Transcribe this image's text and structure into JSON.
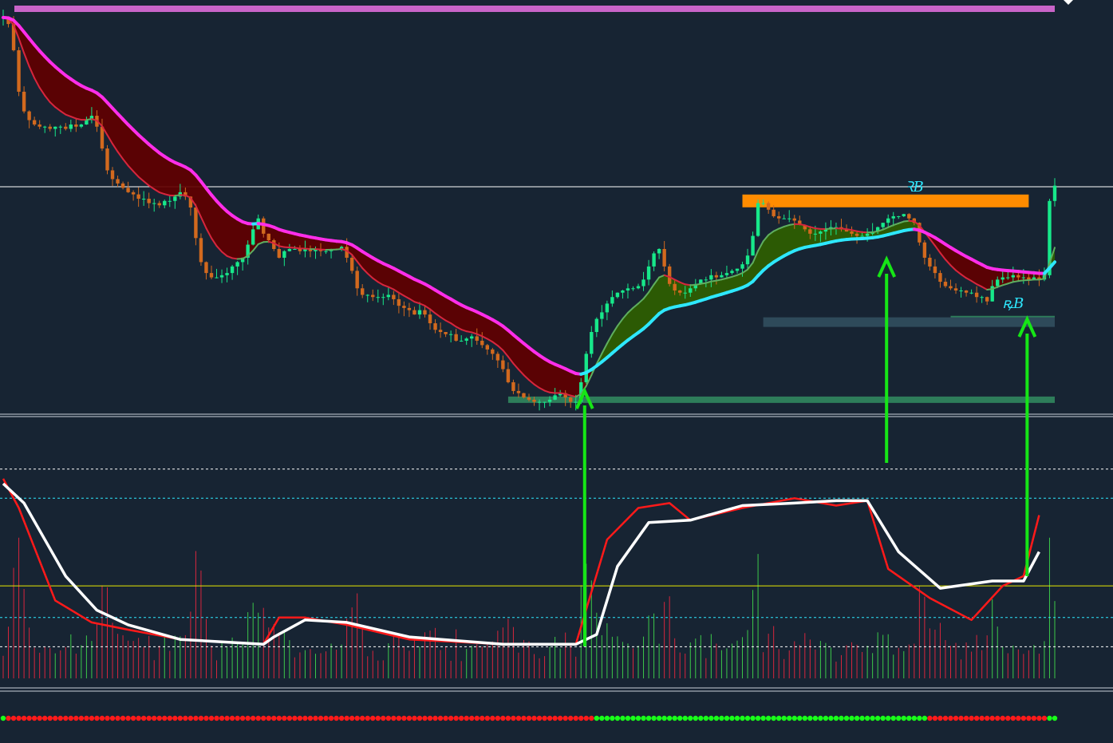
{
  "chart_data": [
    {
      "panel": "price",
      "type": "candlestick",
      "bars": 200,
      "closes": [
        1.25,
        1.247,
        1.235,
        1.216,
        1.207,
        1.203,
        1.201,
        1.2,
        1.2,
        1.199,
        1.2,
        1.2,
        1.199,
        1.201,
        1.2,
        1.201,
        1.203,
        1.205,
        1.2,
        1.19,
        1.18,
        1.176,
        1.174,
        1.172,
        1.17,
        1.169,
        1.167,
        1.167,
        1.165,
        1.165,
        1.164,
        1.166,
        1.166,
        1.168,
        1.17,
        1.168,
        1.163,
        1.149,
        1.138,
        1.133,
        1.131,
        1.131,
        1.132,
        1.133,
        1.136,
        1.138,
        1.14,
        1.146,
        1.153,
        1.158,
        1.151,
        1.148,
        1.144,
        1.14,
        1.143,
        1.144,
        1.144,
        1.143,
        1.144,
        1.143,
        1.144,
        1.143,
        1.143,
        1.144,
        1.144,
        1.145,
        1.14,
        1.134,
        1.126,
        1.123,
        1.123,
        1.122,
        1.122,
        1.122,
        1.123,
        1.121,
        1.118,
        1.117,
        1.116,
        1.114,
        1.116,
        1.114,
        1.11,
        1.107,
        1.106,
        1.105,
        1.105,
        1.102,
        1.102,
        1.103,
        1.104,
        1.102,
        1.1,
        1.098,
        1.096,
        1.093,
        1.089,
        1.083,
        1.079,
        1.078,
        1.076,
        1.075,
        1.074,
        1.074,
        1.074,
        1.075,
        1.077,
        1.078,
        1.076,
        1.074,
        1.074,
        1.083,
        1.096,
        1.106,
        1.112,
        1.115,
        1.119,
        1.122,
        1.124,
        1.125,
        1.126,
        1.126,
        1.127,
        1.13,
        1.136,
        1.142,
        1.144,
        1.136,
        1.128,
        1.125,
        1.124,
        1.124,
        1.126,
        1.128,
        1.13,
        1.13,
        1.132,
        1.131,
        1.132,
        1.133,
        1.134,
        1.135,
        1.137,
        1.141,
        1.15,
        1.165,
        1.165,
        1.162,
        1.159,
        1.158,
        1.158,
        1.158,
        1.157,
        1.155,
        1.153,
        1.151,
        1.151,
        1.152,
        1.153,
        1.154,
        1.154,
        1.153,
        1.152,
        1.151,
        1.15,
        1.15,
        1.151,
        1.152,
        1.154,
        1.156,
        1.158,
        1.159,
        1.159,
        1.16,
        1.158,
        1.156,
        1.147,
        1.14,
        1.136,
        1.133,
        1.129,
        1.127,
        1.126,
        1.125,
        1.125,
        1.124,
        1.124,
        1.122,
        1.122,
        1.12,
        1.127,
        1.13,
        1.131,
        1.131,
        1.132,
        1.131,
        1.131,
        1.13,
        1.131,
        1.13,
        1.132,
        1.166,
        1.173
      ],
      "ylim": [
        1.068,
        1.258
      ],
      "levels": [
        {
          "value": 1.254,
          "color": "#c864c8"
        },
        {
          "value": 1.1725,
          "color": "#ffffff"
        },
        {
          "value": 1.166,
          "color": "#ff8c00"
        },
        {
          "value": 1.1125,
          "color": "#2e7d5a"
        },
        {
          "value": 1.1105,
          "color": "#2e4a5a"
        },
        {
          "value": 1.075,
          "color": "#2e7d5a"
        }
      ],
      "markers": [
        {
          "bar": 175,
          "text": "ꝚB"
        },
        {
          "bar": 194,
          "text": "ꝶB"
        }
      ],
      "colors": {
        "bull": "#17e88a",
        "bear": "#d2691e",
        "ma_slow": "#ff2eea",
        "ma_slow_alt": "#2ee8ff",
        "ma_fast": "#d7263d",
        "ma_fast_alt": "#5fae5f",
        "cloud_down": "#610000",
        "cloud_up": "#2f5f00"
      }
    },
    {
      "panel": "oscillator",
      "type": "line",
      "ylim": [
        0,
        100
      ],
      "levels": [
        {
          "value": 86,
          "color": "#ffffff",
          "dash": true
        },
        {
          "value": 74,
          "color": "#2ee8ff",
          "dash": true
        },
        {
          "value": 38,
          "color": "#e8e800"
        },
        {
          "value": 25,
          "color": "#2ee8ff",
          "dash": true
        },
        {
          "value": 13,
          "color": "#ffffff",
          "dash": true
        }
      ],
      "series": [
        {
          "color": "#ffffff",
          "points": [
            [
              0,
              80
            ],
            [
              4,
              72
            ],
            [
              12,
              42
            ],
            [
              18,
              28
            ],
            [
              24,
              22
            ],
            [
              34,
              16
            ],
            [
              50,
              14
            ],
            [
              52,
              17
            ],
            [
              58,
              24
            ],
            [
              66,
              23
            ],
            [
              78,
              17
            ],
            [
              96,
              14
            ],
            [
              110,
              14
            ],
            [
              114,
              18
            ],
            [
              118,
              46
            ],
            [
              124,
              64
            ],
            [
              132,
              65
            ],
            [
              142,
              71
            ],
            [
              152,
              72
            ],
            [
              160,
              73
            ],
            [
              166,
              73
            ],
            [
              172,
              52
            ],
            [
              180,
              37
            ],
            [
              190,
              40
            ],
            [
              196,
              40
            ],
            [
              199,
              52
            ]
          ]
        },
        {
          "color": "#ff1a1a",
          "points": [
            [
              0,
              82
            ],
            [
              3,
              70
            ],
            [
              10,
              32
            ],
            [
              17,
              23
            ],
            [
              24,
              20
            ],
            [
              34,
              16
            ],
            [
              50,
              14
            ],
            [
              53,
              25
            ],
            [
              58,
              25
            ],
            [
              66,
              22
            ],
            [
              78,
              16
            ],
            [
              96,
              14
            ],
            [
              110,
              14
            ],
            [
              116,
              57
            ],
            [
              122,
              70
            ],
            [
              128,
              72
            ],
            [
              132,
              65
            ],
            [
              142,
              70
            ],
            [
              152,
              74
            ],
            [
              160,
              71
            ],
            [
              166,
              73
            ],
            [
              170,
              45
            ],
            [
              178,
              33
            ],
            [
              186,
              24
            ],
            [
              192,
              38
            ],
            [
              196,
              42
            ],
            [
              199,
              67
            ]
          ]
        }
      ]
    }
  ],
  "histogram": {
    "colors": {
      "up": "#3cc84a",
      "down": "#d7263d"
    }
  },
  "dots": {
    "count": 200,
    "colors": {
      "red": "#ff1a1a",
      "green": "#19ff19"
    }
  },
  "arrows": {
    "color": "#16e616",
    "at_bars": [
      112,
      170,
      197
    ]
  }
}
